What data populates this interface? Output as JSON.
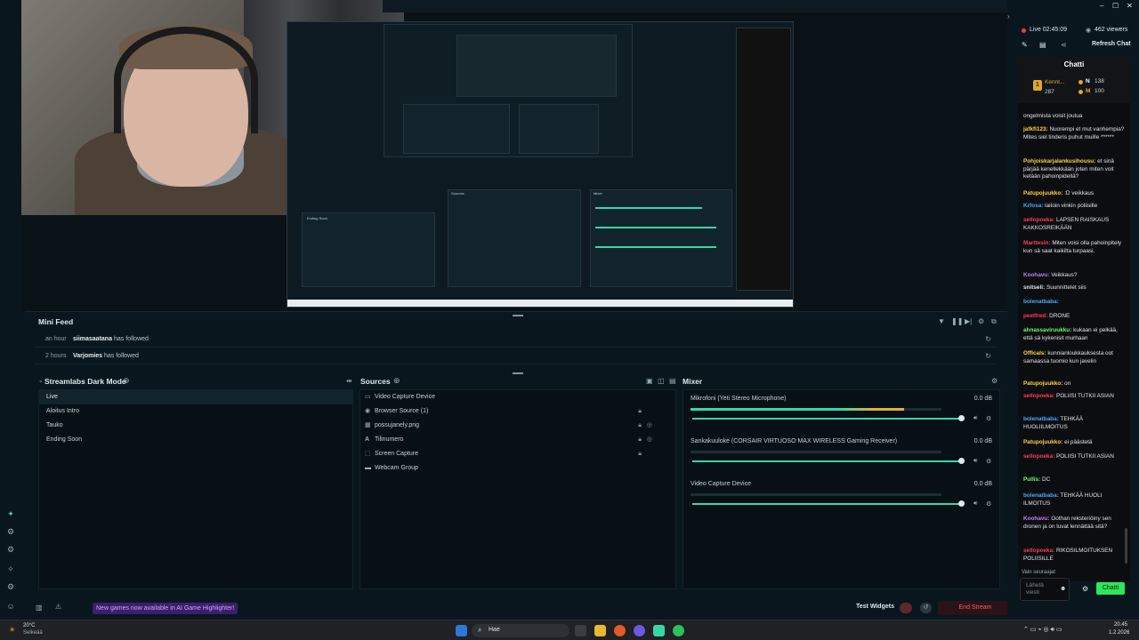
{
  "preview": {
    "screen_labels": {
      "sources": "Sources",
      "mixer": "Mixer",
      "ending": "Ending Soon"
    }
  },
  "minifeed": {
    "title": "Mini Feed",
    "rows": [
      {
        "time": "an hour",
        "name": "siimasaatana",
        "action": "has followed"
      },
      {
        "time": "2 hours",
        "name": "Varjomies",
        "action": "has followed"
      }
    ]
  },
  "scenes": {
    "title": "Streamlabs Dark Mode",
    "items": [
      "Live",
      "Aloitus Intro",
      "Tauko",
      "Ending Soon"
    ]
  },
  "sources": {
    "title": "Sources",
    "items": [
      {
        "name": "Video Capture Device",
        "icon": "camera-icon",
        "locked": false
      },
      {
        "name": "Browser Source (1)",
        "icon": "globe-icon",
        "locked": true
      },
      {
        "name": "possujanely.png",
        "icon": "image-icon",
        "locked": true
      },
      {
        "name": "Tilinumero",
        "icon": "text-icon",
        "locked": true
      },
      {
        "name": "Screen Capture",
        "icon": "screen-icon",
        "locked": true
      },
      {
        "name": "Webcam Group",
        "icon": "folder-icon",
        "locked": false
      }
    ]
  },
  "mixer": {
    "title": "Mixer",
    "channels": [
      {
        "name": "Mikrofoni (Yeti Stereo Microphone)",
        "db": "0.0 dB",
        "level": 0.85,
        "peak": 0.95
      },
      {
        "name": "Sankakuuloke (CORSAIR VIRTUOSO MAX WIRELESS Gaming Receiver)",
        "db": "0.0 dB",
        "level": 0.0,
        "peak": 0.0
      },
      {
        "name": "Video Capture Device",
        "db": "0.0 dB",
        "level": 0.0,
        "peak": 0.0
      }
    ]
  },
  "bottombar": {
    "notification": "New games now available in AI Game Highlighter!",
    "test_widgets": "Test Widgets",
    "end_stream": "End Stream"
  },
  "status": {
    "live": "Live 02:45:09",
    "viewers": "462 viewers",
    "refresh": "Refresh Chat"
  },
  "chat": {
    "title": "Chatti",
    "leader": {
      "name": "Kennt...",
      "count": "287",
      "n_label": "N",
      "n_value": "138",
      "m_label": "M",
      "m_value": "100"
    },
    "messages": [
      {
        "user": "",
        "color": "#e2e6e8",
        "text": "ongelmista voisit joutua"
      },
      {
        "user": "jafkfi123:",
        "color": "#ffd24a",
        "text": "Nuorempi et mut vanhempia? Mites siel tinderis puhut muille ******"
      },
      {
        "user": "Pohjoiskarjalankusihousu:",
        "color": "#ffd24a",
        "text": "et sinä pärjää kenellekkään joten miten voit ketään pahoinpidellä?"
      },
      {
        "user": "Patupojuukko:",
        "color": "#ffd24a",
        "text": ":D veikkaus"
      },
      {
        "user": "Krfosa:",
        "color": "#4aa8ff",
        "text": "laitoin vinkin poliisille"
      },
      {
        "user": "sellopoeka:",
        "color": "#ff3b5c",
        "text": "LAPSEN RAISKAUS KAKKOSREIKÄÄN"
      },
      {
        "user": "Marttesin:",
        "color": "#ff3b5c",
        "text": "Miten voisi olla pahoinpitely kun sä saat kaikilta turpaasi."
      },
      {
        "user": "Koohavu:",
        "color": "#c77dff",
        "text": "Veikkaus?"
      },
      {
        "user": "snitseli:",
        "color": "#e2e6e8",
        "text": "Suunnittelet siis"
      },
      {
        "user": "bolenatbaba:",
        "color": "#4aa8ff",
        "text": ""
      },
      {
        "user": "peetfred:",
        "color": "#ff3b5c",
        "text": "DRONE"
      },
      {
        "user": "ahnassaviruukku:",
        "color": "#6bff6b",
        "text": "kukaan ei pelkää, että sä kykenisit murhaan"
      },
      {
        "user": "Officals:",
        "color": "#ffd24a",
        "text": "kunnianloukkauksesta oot samaassa tuomio kun javelin"
      },
      {
        "user": "Patupojuukko:",
        "color": "#ffd24a",
        "text": "on"
      },
      {
        "user": "sellopoeka:",
        "color": "#ff3b5c",
        "text": "POLIISI TUTKII ASIAN"
      },
      {
        "user": "bolenatbaba:",
        "color": "#4aa8ff",
        "text": "TEHKÄÄ HUOLIILMOITUS"
      },
      {
        "user": "Patupojuukko:",
        "color": "#ffd24a",
        "text": "ei päästetä"
      },
      {
        "user": "sellopoeka:",
        "color": "#ff3b5c",
        "text": "POLIISI TUTKII ASIAN"
      },
      {
        "user": "Pullis:",
        "color": "#6bff6b",
        "text": "DC"
      },
      {
        "user": "bolenatbaba:",
        "color": "#4aa8ff",
        "text": "TEHKÄÄ HUOLI ILMOITUS"
      },
      {
        "user": "Koohavu:",
        "color": "#c77dff",
        "text": "Oothan reksteriöiny sen dronen ja on luvat lennättää sitä?"
      },
      {
        "user": "sellopoeka:",
        "color": "#ff3b5c",
        "text": "RIKOSILMOITUKSEN POLIISILLE"
      }
    ],
    "followers_only": "Vain seuraajat",
    "input_placeholder": "Lähetä viesti",
    "send_label": "Chatti"
  },
  "taskbar": {
    "temp": "20°C",
    "weather": "Selkeää",
    "search": "Hae",
    "time": "20.45",
    "date": "1.2.2026"
  },
  "colors": {
    "accent": "#38d7a6",
    "bg": "#09161d",
    "panel": "#071017",
    "end_stream": "#ff5a6b",
    "notif": "#3b1f6b"
  }
}
